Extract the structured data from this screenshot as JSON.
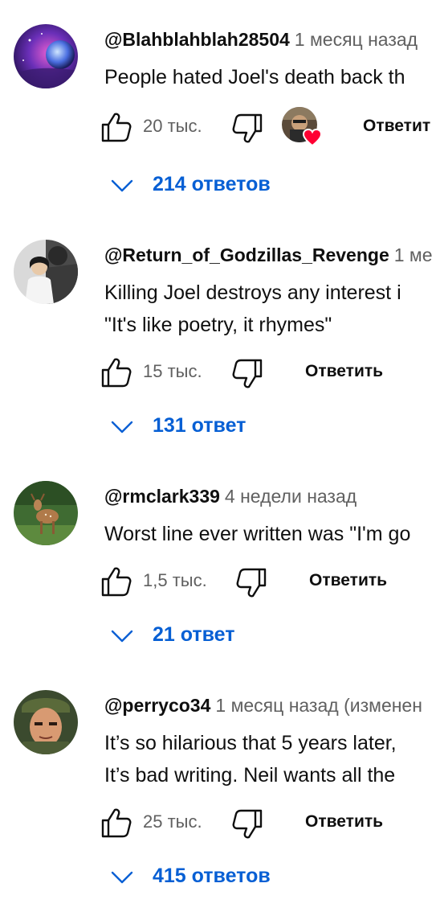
{
  "comments": [
    {
      "author": "@Blahblahblah28504",
      "time": "1 месяц назад",
      "text": [
        "People hated Joel's death back th"
      ],
      "likes": "20 тыс.",
      "reply": "Ответит",
      "replies": "214 ответов",
      "creator_heart": true
    },
    {
      "author": "@Return_of_Godzillas_Revenge",
      "time": "1 ме",
      "text": [
        "Killing Joel destroys any interest i",
        "\"It's like poetry, it rhymes\""
      ],
      "likes": "15 тыс.",
      "reply": "Ответить",
      "replies": "131 ответ"
    },
    {
      "author": "@rmclark339",
      "time": "4 недели назад",
      "text": [
        "Worst line ever written was \"I'm go"
      ],
      "likes": "1,5 тыс.",
      "reply": "Ответить",
      "replies": "21 ответ"
    },
    {
      "author": "@perryco34",
      "time": "1 месяц назад (изменен",
      "text": [
        "It’s so hilarious that 5 years later,",
        "It’s bad writing. Neil wants all the"
      ],
      "likes": "25 тыс.",
      "reply": "Ответить",
      "replies": "415 ответов"
    }
  ],
  "colors": {
    "link_blue": "#065fd4",
    "secondary_text": "#606060",
    "heart_red": "#ff0033"
  },
  "icons": [
    "like-icon",
    "dislike-icon",
    "chevron-down-icon",
    "creator-heart-icon"
  ]
}
